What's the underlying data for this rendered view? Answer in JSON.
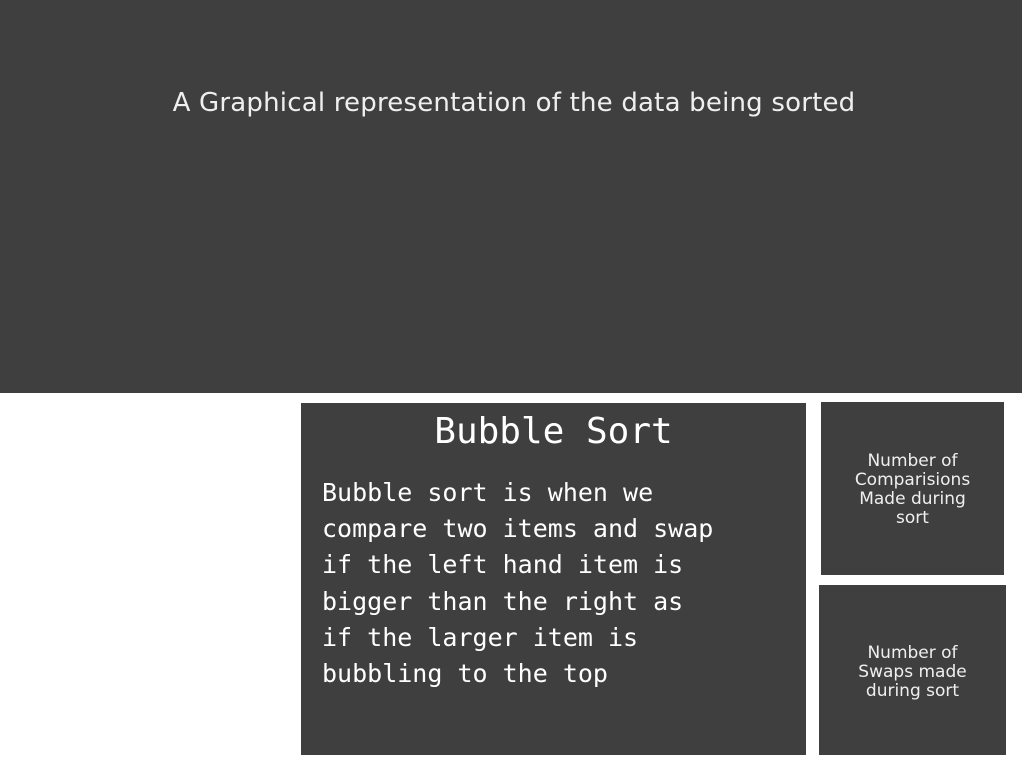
{
  "graph": {
    "caption": "A Graphical representation of the data being sorted"
  },
  "algorithm": {
    "title": "Bubble Sort",
    "description": "Bubble sort is when we\ncompare two items and swap\nif the left hand item is\nbigger than the right as\nif the larger item is\nbubbling to the top"
  },
  "stats": {
    "comparisons_label": "Number of\nComparisions\nMade during\nsort",
    "swaps_label": "Number of\nSwaps made\nduring sort"
  },
  "colors": {
    "panel": "#3f3f3f",
    "background": "#ffffff",
    "text": "#efefef"
  }
}
